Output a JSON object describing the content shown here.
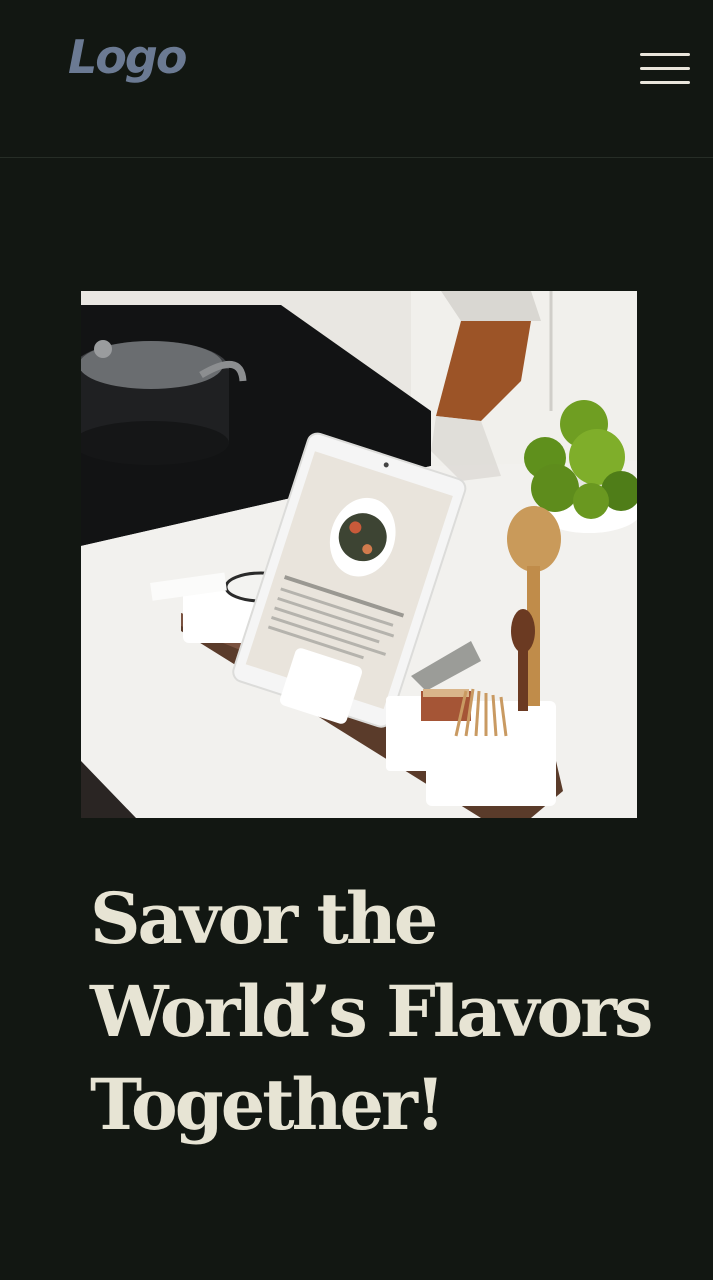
{
  "header": {
    "logo_text": "Logo",
    "menu_icon": "hamburger-menu-icon"
  },
  "hero": {
    "image_subject": "tablet-on-kitchen-counter",
    "headline_lines": [
      "Savor the",
      "World’s Flavors",
      "Together!"
    ]
  },
  "colors": {
    "background": "#121712",
    "headline": "#e7e4d4",
    "logo": "#6b7a93",
    "menu_icon": "#e9e6dc"
  }
}
